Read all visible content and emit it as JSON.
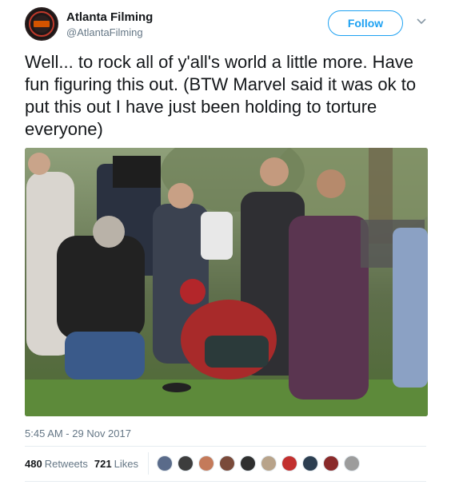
{
  "header": {
    "name": "Atlanta Filming",
    "handle": "@AtlantaFilming",
    "follow_label": "Follow",
    "avatar_icon": "atlanta-filming-logo",
    "caret_icon": "chevron-down-icon"
  },
  "tweet": {
    "text": "Well... to rock all of y'all's world a little more. Have fun figuring this out. (BTW Marvel said it was ok to put this out I have just been holding to torture everyone)",
    "timestamp": "5:45 AM - 29 Nov 2017"
  },
  "stats": {
    "retweets_count": "480",
    "retweets_label": "Retweets",
    "likes_count": "721",
    "likes_label": "Likes",
    "liker_avatar_colors": [
      "#5a6b8a",
      "#3d3d3d",
      "#c47a5a",
      "#7a4a3a",
      "#2f2f2f",
      "#b8a38a",
      "#c2302f",
      "#2c3e50",
      "#8a2a2a",
      "#9c9c9c"
    ]
  },
  "colors": {
    "accent": "#1da1f2",
    "secondary_text": "#657786",
    "primary_text": "#14171a",
    "divider": "#e6ecf0"
  }
}
